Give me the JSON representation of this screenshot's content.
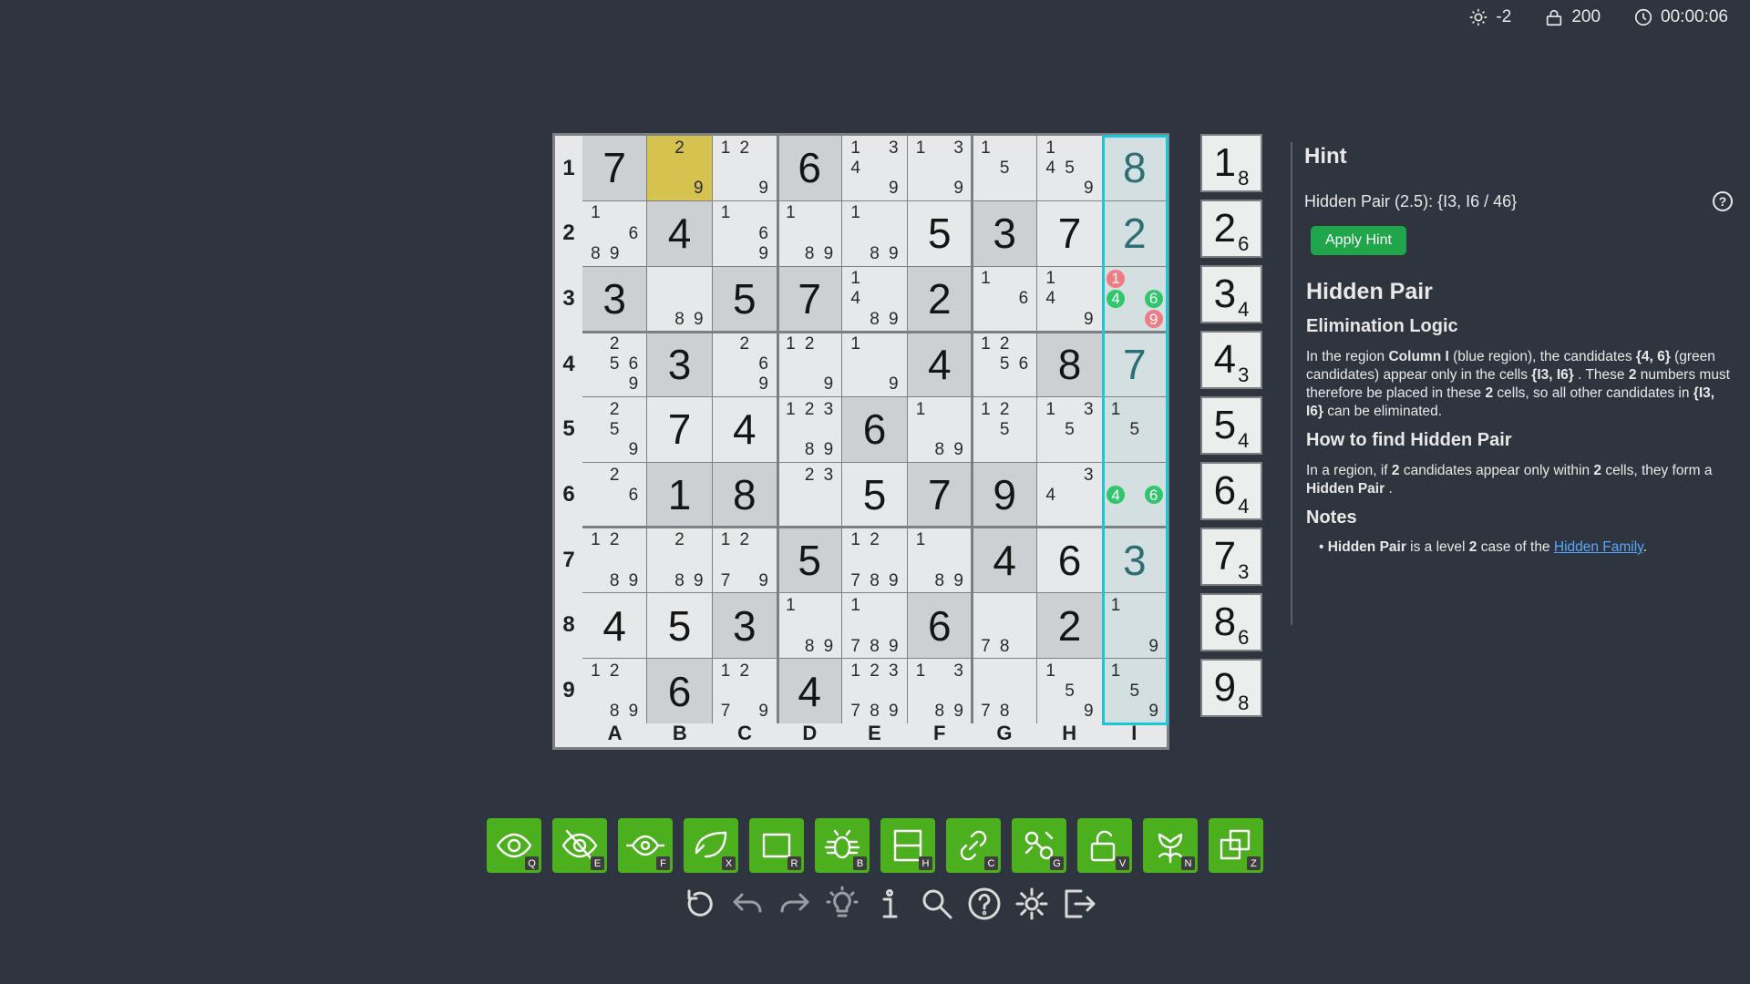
{
  "status": {
    "brightness": "-2",
    "score": "200",
    "timer": "00:00:06"
  },
  "board": {
    "row_labels": [
      "1",
      "2",
      "3",
      "4",
      "5",
      "6",
      "7",
      "8",
      "9"
    ],
    "col_labels": [
      "A",
      "B",
      "C",
      "D",
      "E",
      "F",
      "G",
      "H",
      "I"
    ],
    "cells": [
      [
        {
          "v": "7",
          "g": true
        },
        {
          "c": [
            "",
            "2",
            "",
            "",
            "",
            "",
            "",
            "",
            "9"
          ],
          "sel": true
        },
        {
          "c": [
            "1",
            "2",
            "",
            "",
            "",
            "",
            "",
            "",
            "9"
          ]
        },
        {
          "v": "6",
          "g": true
        },
        {
          "c": [
            "1",
            "",
            "3",
            "4",
            "",
            "",
            "",
            "",
            "9"
          ]
        },
        {
          "c": [
            "1",
            "",
            "3",
            "",
            "",
            "",
            "",
            "",
            "9"
          ]
        },
        {
          "c": [
            "1",
            "",
            "",
            "",
            "5",
            "",
            "",
            "",
            ""
          ]
        },
        {
          "c": [
            "1",
            "",
            "",
            "4",
            "5",
            "",
            "",
            "",
            "9"
          ]
        },
        {
          "v": "8",
          "g": true
        }
      ],
      [
        {
          "c": [
            "1",
            "",
            "",
            "",
            "",
            "6",
            "8",
            "9",
            ""
          ]
        },
        {
          "v": "4",
          "g": true
        },
        {
          "c": [
            "1",
            "",
            "",
            "",
            "",
            "6",
            "",
            "",
            "9"
          ]
        },
        {
          "c": [
            "1",
            "",
            "",
            "",
            "",
            "",
            "",
            "8",
            "9"
          ]
        },
        {
          "c": [
            "1",
            "",
            "",
            "",
            "",
            "",
            "",
            "8",
            "9"
          ]
        },
        {
          "v": "5"
        },
        {
          "v": "3",
          "g": true
        },
        {
          "v": "7"
        },
        {
          "v": "2",
          "g": true
        }
      ],
      [
        {
          "v": "3",
          "g": true
        },
        {
          "c": [
            "",
            "",
            "",
            "",
            "",
            "",
            "",
            "8",
            "9"
          ]
        },
        {
          "v": "5",
          "g": true
        },
        {
          "v": "7",
          "g": true
        },
        {
          "c": [
            "1",
            "",
            "",
            "4",
            "",
            "",
            "",
            "8",
            "9"
          ]
        },
        {
          "v": "2",
          "g": true
        },
        {
          "c": [
            "1",
            "",
            "",
            "",
            "",
            "6",
            "",
            "",
            ""
          ]
        },
        {
          "c": [
            "1",
            "",
            "",
            "4",
            "",
            "",
            "",
            "",
            "9"
          ]
        },
        {
          "c": [
            "1",
            "",
            "",
            "4",
            "",
            "6",
            "",
            "",
            "9"
          ],
          "hl": {
            "0": "r",
            "3": "g",
            "5": "g",
            "8": "r"
          }
        }
      ],
      [
        {
          "c": [
            "",
            "2",
            "",
            "",
            "5",
            "6",
            "",
            "",
            "9"
          ]
        },
        {
          "v": "3",
          "g": true
        },
        {
          "c": [
            "",
            "2",
            "",
            "",
            "",
            "6",
            "",
            "",
            "9"
          ]
        },
        {
          "c": [
            "1",
            "2",
            "",
            "",
            "",
            "",
            "",
            "",
            "9"
          ]
        },
        {
          "c": [
            "1",
            "",
            "",
            "",
            "",
            "",
            "",
            "",
            "9"
          ]
        },
        {
          "v": "4",
          "g": true
        },
        {
          "c": [
            "1",
            "2",
            "",
            "",
            "5",
            "6",
            "",
            "",
            ""
          ]
        },
        {
          "v": "8",
          "g": true
        },
        {
          "v": "7",
          "g": true
        }
      ],
      [
        {
          "c": [
            "",
            "2",
            "",
            "",
            "5",
            "",
            "",
            "",
            "9"
          ]
        },
        {
          "v": "7"
        },
        {
          "v": "4"
        },
        {
          "c": [
            "1",
            "2",
            "3",
            "",
            "",
            "",
            "",
            "8",
            "9"
          ]
        },
        {
          "v": "6",
          "g": true
        },
        {
          "c": [
            "1",
            "",
            "",
            "",
            "",
            "",
            "",
            "8",
            "9"
          ]
        },
        {
          "c": [
            "1",
            "2",
            "",
            "",
            "5",
            "",
            "",
            "",
            ""
          ]
        },
        {
          "c": [
            "1",
            "",
            "3",
            "",
            "5",
            "",
            "",
            "",
            ""
          ]
        },
        {
          "c": [
            "1",
            "",
            "",
            "",
            "5",
            "",
            "",
            "",
            ""
          ]
        }
      ],
      [
        {
          "c": [
            "",
            "2",
            "",
            "",
            "",
            "6",
            "",
            "",
            ""
          ]
        },
        {
          "v": "1",
          "g": true
        },
        {
          "v": "8",
          "g": true
        },
        {
          "c": [
            "",
            "2",
            "3",
            "",
            "",
            "",
            "",
            "",
            ""
          ]
        },
        {
          "v": "5"
        },
        {
          "v": "7",
          "g": true
        },
        {
          "v": "9",
          "g": true
        },
        {
          "c": [
            "",
            "",
            "3",
            "4",
            "",
            "",
            "",
            "",
            ""
          ]
        },
        {
          "c": [
            "",
            "",
            "",
            "4",
            "",
            "6",
            "",
            "",
            ""
          ],
          "hl": {
            "3": "g",
            "5": "g"
          }
        }
      ],
      [
        {
          "c": [
            "1",
            "2",
            "",
            "",
            "",
            "",
            "",
            "8",
            "9"
          ]
        },
        {
          "c": [
            "",
            "2",
            "",
            "",
            "",
            "",
            "",
            "8",
            "9"
          ]
        },
        {
          "c": [
            "1",
            "2",
            "",
            "",
            "",
            "",
            "7",
            "",
            "9"
          ]
        },
        {
          "v": "5",
          "g": true
        },
        {
          "c": [
            "1",
            "2",
            "",
            "",
            "",
            "",
            "7",
            "8",
            "9"
          ]
        },
        {
          "c": [
            "1",
            "",
            "",
            "",
            "",
            "",
            "",
            "8",
            "9"
          ]
        },
        {
          "v": "4",
          "g": true
        },
        {
          "v": "6"
        },
        {
          "v": "3",
          "g": true
        }
      ],
      [
        {
          "v": "4"
        },
        {
          "v": "5"
        },
        {
          "v": "3",
          "g": true
        },
        {
          "c": [
            "1",
            "",
            "",
            "",
            "",
            "",
            "",
            "8",
            "9"
          ]
        },
        {
          "c": [
            "1",
            "",
            "",
            "",
            "",
            "",
            "7",
            "8",
            "9"
          ]
        },
        {
          "v": "6",
          "g": true
        },
        {
          "c": [
            "",
            "",
            "",
            "",
            "",
            "",
            "7",
            "8",
            ""
          ]
        },
        {
          "v": "2",
          "g": true
        },
        {
          "c": [
            "1",
            "",
            "",
            "",
            "",
            "",
            "",
            "",
            "9"
          ]
        }
      ],
      [
        {
          "c": [
            "1",
            "2",
            "",
            "",
            "",
            "",
            "",
            "8",
            "9"
          ]
        },
        {
          "v": "6",
          "g": true
        },
        {
          "c": [
            "1",
            "2",
            "",
            "",
            "",
            "",
            "7",
            "",
            "9"
          ]
        },
        {
          "v": "4",
          "g": true
        },
        {
          "c": [
            "1",
            "2",
            "3",
            "",
            "",
            "",
            "7",
            "8",
            "9"
          ]
        },
        {
          "c": [
            "1",
            "",
            "3",
            "",
            "",
            "",
            "",
            "8",
            "9"
          ]
        },
        {
          "c": [
            "",
            "",
            "",
            "",
            "",
            "",
            "7",
            "8",
            ""
          ]
        },
        {
          "c": [
            "1",
            "",
            "",
            "",
            "5",
            "",
            "",
            "",
            "9"
          ]
        },
        {
          "c": [
            "1",
            "",
            "",
            "",
            "5",
            "",
            "",
            "",
            "9"
          ]
        }
      ]
    ]
  },
  "counts": [
    {
      "n": "1",
      "c": "8"
    },
    {
      "n": "2",
      "c": "6"
    },
    {
      "n": "3",
      "c": "4"
    },
    {
      "n": "4",
      "c": "3"
    },
    {
      "n": "5",
      "c": "4"
    },
    {
      "n": "6",
      "c": "4"
    },
    {
      "n": "7",
      "c": "3"
    },
    {
      "n": "8",
      "c": "6"
    },
    {
      "n": "9",
      "c": "8"
    }
  ],
  "hint": {
    "title": "Hint",
    "summary": "Hidden Pair (2.5): {I3, I6 / 46}",
    "apply_label": "Apply Hint",
    "help": "?",
    "technique": "Hidden Pair",
    "s1_title": "Elimination Logic",
    "s1_a": "In the region ",
    "s1_b": "Column I",
    "s1_c": " (blue region), the candidates ",
    "s1_d": "{4, 6}",
    "s1_e": " (green candidates) appear only in the cells ",
    "s1_f": "{I3, I6}",
    "s1_g": " . These ",
    "s1_h": "2",
    "s1_i": " numbers must therefore be placed in these ",
    "s1_j": "2",
    "s1_k": " cells, so all other candidates in ",
    "s1_l": "{I3, I6}",
    "s1_m": " can be eliminated.",
    "s2_title": "How to find Hidden Pair",
    "s2_a": "In a region, if ",
    "s2_b": "2",
    "s2_c": " candidates appear only within ",
    "s2_d": "2",
    "s2_e": " cells, they form a ",
    "s2_f": "Hidden Pair",
    "s2_g": " .",
    "s3_title": "Notes",
    "n_a": "Hidden Pair",
    "n_b": " is a level ",
    "n_c": "2",
    "n_d": " case of the ",
    "n_link": "Hidden Family",
    "n_e": "."
  },
  "tools": [
    {
      "icon": "eye-icon",
      "key": "Q"
    },
    {
      "icon": "eye-off-icon",
      "key": "E"
    },
    {
      "icon": "eye-focus-icon",
      "key": "F"
    },
    {
      "icon": "leaf-x-icon",
      "key": "X"
    },
    {
      "icon": "rectangle-icon",
      "key": "R"
    },
    {
      "icon": "bug-icon",
      "key": "B"
    },
    {
      "icon": "split-box-icon",
      "key": "H"
    },
    {
      "icon": "link-icon",
      "key": "C"
    },
    {
      "icon": "chain-icon",
      "key": "G"
    },
    {
      "icon": "unlock-icon",
      "key": "V"
    },
    {
      "icon": "flower-icon",
      "key": "N"
    },
    {
      "icon": "copy-icon",
      "key": "Z"
    }
  ],
  "colors": {
    "accent": "#4caf1e",
    "highlight_col": "#1bc6d6",
    "selected": "#d6c24f",
    "cand_green": "#31c56d",
    "cand_red": "#ef7b83"
  }
}
